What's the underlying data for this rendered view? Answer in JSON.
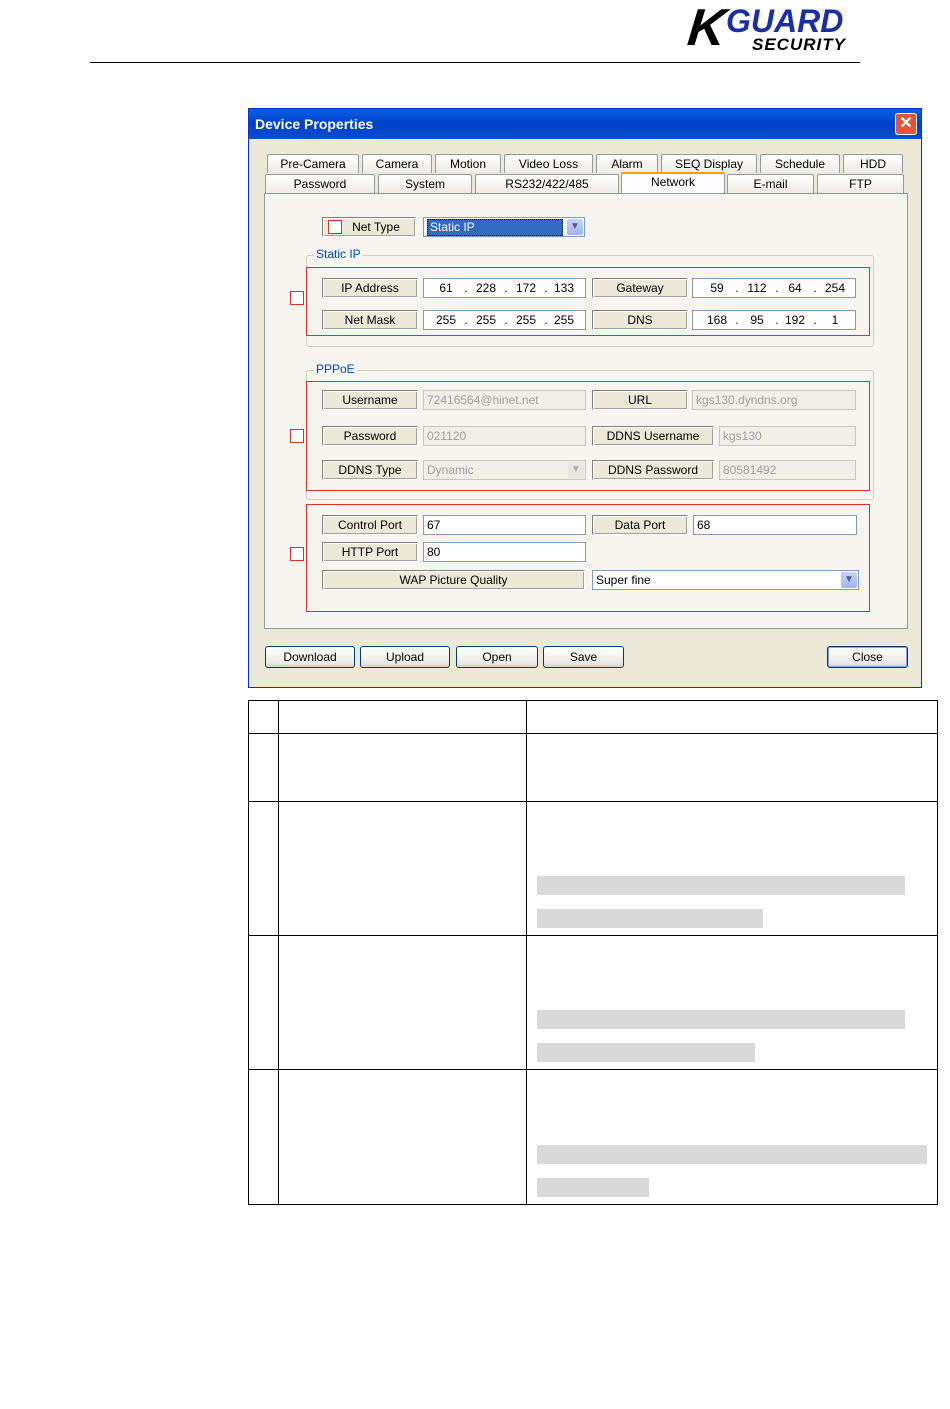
{
  "brand": {
    "logo_k": "K",
    "logo_guard": "GUARD",
    "logo_security": "SECURITY"
  },
  "dialog": {
    "title": "Device Properties",
    "close_glyph": "✕",
    "tabs_row1": [
      "Pre-Camera",
      "Camera",
      "Motion",
      "Video Loss",
      "Alarm",
      "SEQ Display",
      "Schedule",
      "HDD"
    ],
    "tabs_row2": [
      "Password",
      "System",
      "RS232/422/485",
      "Network",
      "E-mail",
      "FTP"
    ],
    "active_tab": "Network",
    "net_type": {
      "label": "Net Type",
      "value": "Static IP"
    },
    "static_ip": {
      "group_title": "Static IP",
      "ip_label": "IP Address",
      "ip": [
        "61",
        "228",
        "172",
        "133"
      ],
      "gateway_label": "Gateway",
      "gateway": [
        "59",
        "112",
        "64",
        "254"
      ],
      "mask_label": "Net Mask",
      "mask": [
        "255",
        "255",
        "255",
        "255"
      ],
      "dns_label": "DNS",
      "dns": [
        "168",
        "95",
        "192",
        "1"
      ]
    },
    "pppoe": {
      "group_title": "PPPoE",
      "username_label": "Username",
      "username": "72416564@hinet.net",
      "url_label": "URL",
      "url": "kgs130.dyndns.org",
      "password_label": "Password",
      "password": "021120",
      "ddns_user_label": "DDNS Username",
      "ddns_user": "kgs130",
      "ddns_type_label": "DDNS Type",
      "ddns_type": "Dynamic",
      "ddns_pass_label": "DDNS Password",
      "ddns_pass": "80581492"
    },
    "ports": {
      "control_label": "Control Port",
      "control": "67",
      "data_label": "Data Port",
      "data": "68",
      "http_label": "HTTP Port",
      "http": "80",
      "wap_label": "WAP Picture Quality",
      "wap": "Super fine"
    },
    "buttons": {
      "download": "Download",
      "upload": "Upload",
      "open": "Open",
      "save": "Save",
      "close": "Close"
    },
    "dropdown_glyph": "▼"
  }
}
